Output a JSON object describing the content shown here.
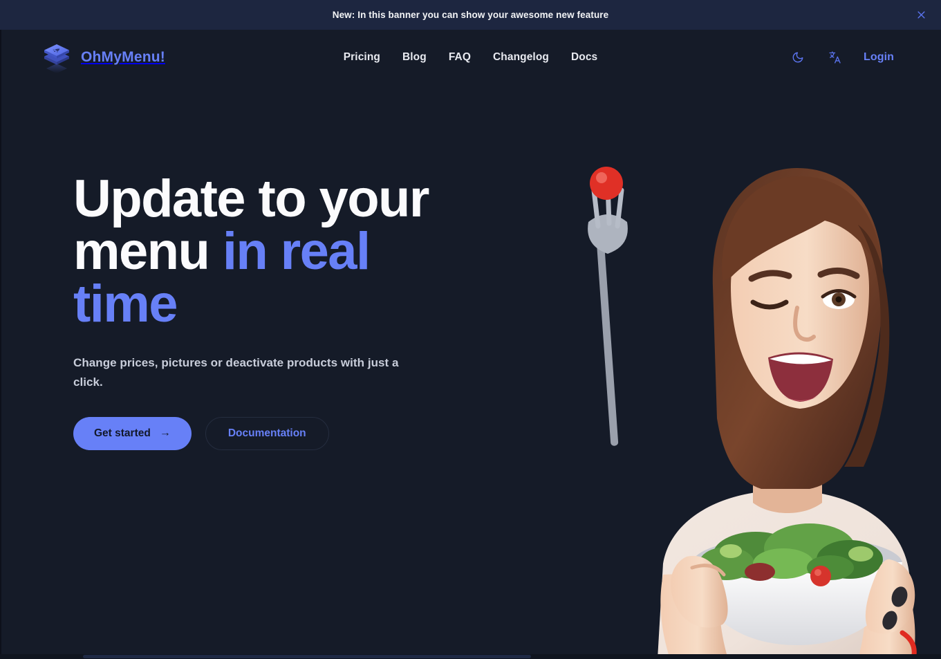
{
  "banner": {
    "text": "New: In this banner you can show your awesome new feature",
    "close_icon": "close-icon",
    "background": "#1d2640"
  },
  "header": {
    "brand": {
      "name": "OhMyMenu!",
      "icon": "layers-rocket-logo-icon",
      "color": "#6780f7"
    },
    "nav": [
      {
        "label": "Pricing"
      },
      {
        "label": "Blog"
      },
      {
        "label": "FAQ"
      },
      {
        "label": "Changelog"
      },
      {
        "label": "Docs"
      }
    ],
    "actions": {
      "theme_toggle_icon": "moon-icon",
      "language_icon": "translate-icon",
      "login_label": "Login"
    }
  },
  "hero": {
    "title_plain": "Update to your menu ",
    "title_accent": "in real time",
    "subtitle": "Change prices, pictures or deactivate products with just a click.",
    "primary_button": {
      "label": "Get started",
      "arrow": "→"
    },
    "secondary_button": {
      "label": "Documentation"
    },
    "image_alt": "Smiling woman winking while eating a bowl of green salad with a fork"
  },
  "theme": {
    "page_background": "#151b28",
    "accent": "#6780f7",
    "text_primary": "#fbfbfd",
    "text_muted": "#c8cdda"
  }
}
